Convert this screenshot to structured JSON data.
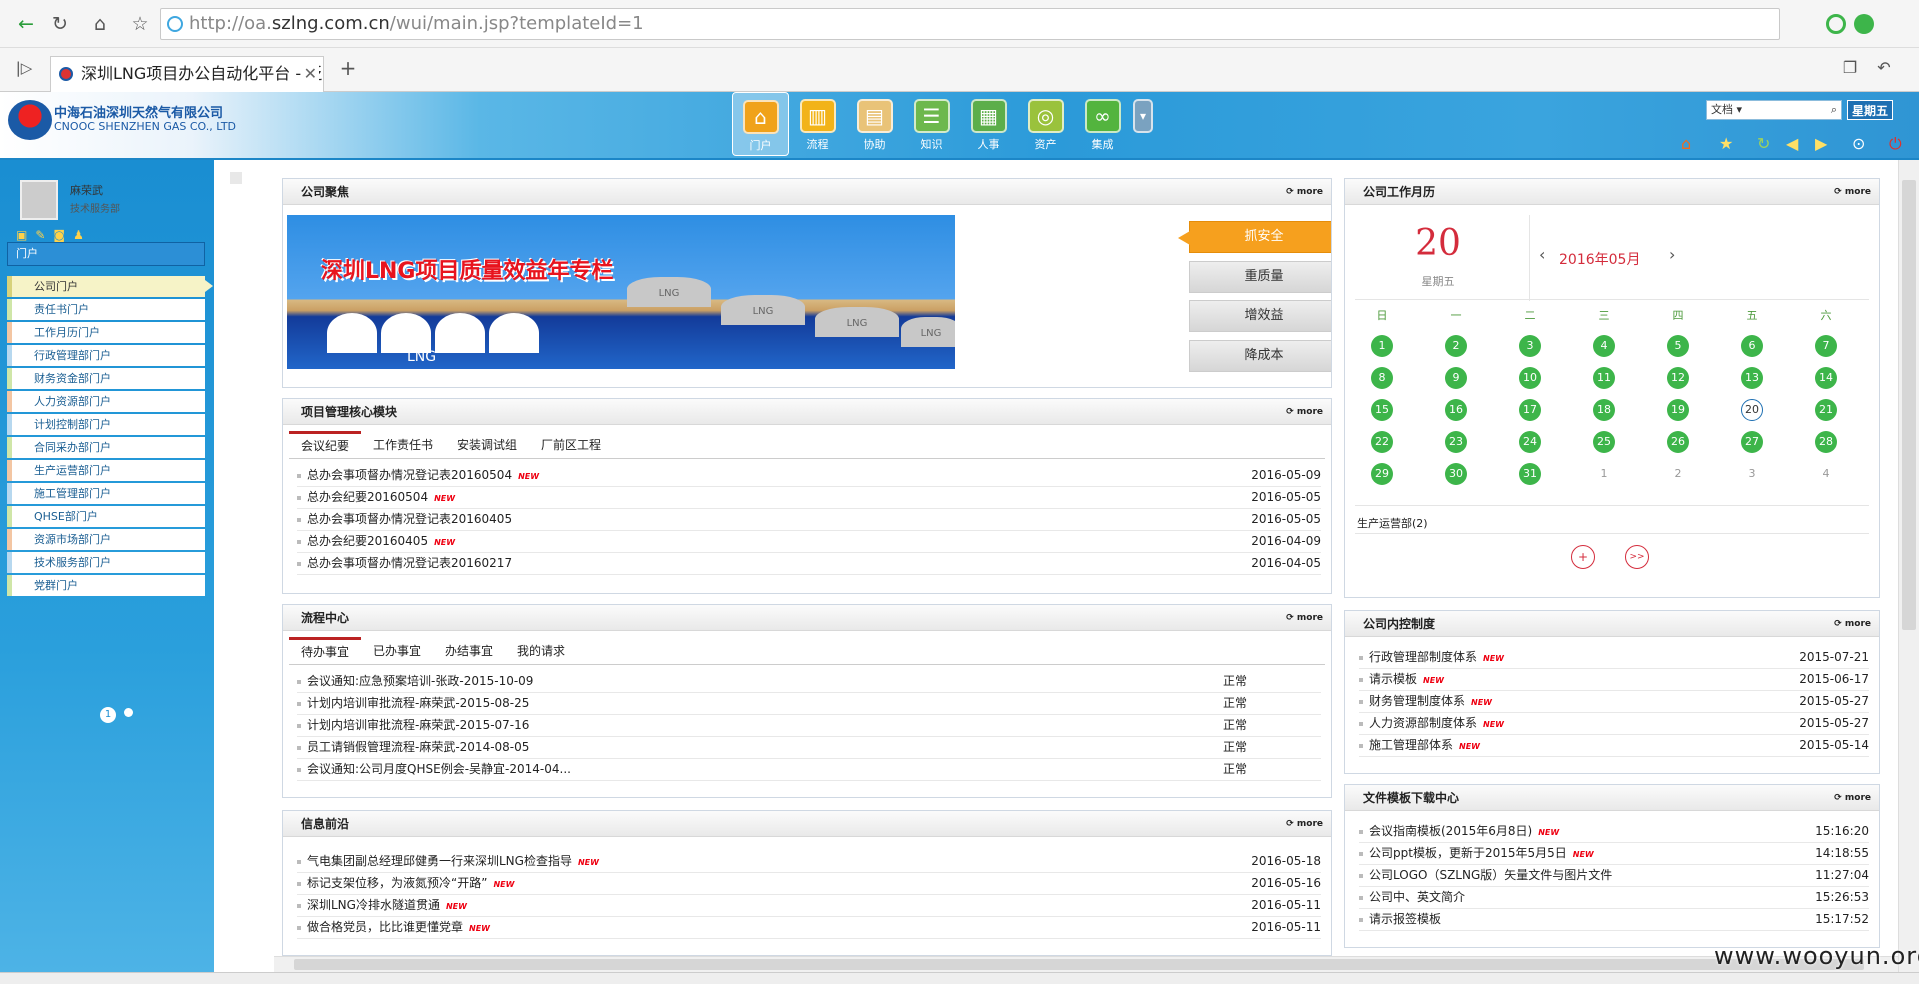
{
  "browser": {
    "url_prefix": "http://oa.",
    "url_host": "szlng.com.cn",
    "url_path": "/wui/main.jsp?templateId=1",
    "tab_title": "深圳LNG项目办公自动化平台 - 泛"
  },
  "header": {
    "company_cn": "中海石油深圳天然气有限公司",
    "company_en": "CNOOC SHENZHEN GAS CO., LTD",
    "modules": [
      "门户",
      "流程",
      "协助",
      "知识",
      "人事",
      "资产",
      "集成"
    ],
    "search_value": "文档",
    "weekday": "星期五"
  },
  "sidebar": {
    "user_name": "麻荣武",
    "user_dept": "技术服务部",
    "portal_select": "门户",
    "items": [
      "公司门户",
      "责任书门户",
      "工作月历门户",
      "行政管理部门户",
      "财务资金部门户",
      "人力资源部门户",
      "计划控制部门户",
      "合同采办部门户",
      "生产运营部门户",
      "施工管理部门户",
      "QHSE部门户",
      "资源市场部门户",
      "技术服务部门户",
      "党群门户"
    ],
    "page_num": "1"
  },
  "focus": {
    "title": "公司聚焦",
    "more": "more",
    "banner_title": "深圳LNG项目质量效益年专栏",
    "banner_lng": "LNG",
    "tank_label": "LNG",
    "buttons": [
      "抓安全",
      "重质量",
      "增效益",
      "降成本"
    ]
  },
  "core": {
    "title": "项目管理核心模块",
    "more": "more",
    "tabs": [
      "会议纪要",
      "工作责任书",
      "安装调试组",
      "厂前区工程"
    ],
    "rows": [
      {
        "text": "总办会事项督办情况登记表20160504",
        "date": "2016-05-09",
        "new": "NEW"
      },
      {
        "text": "总办会纪要20160504",
        "date": "2016-05-05",
        "new": "NEW"
      },
      {
        "text": "总办会事项督办情况登记表20160405",
        "date": "2016-05-05",
        "new": ""
      },
      {
        "text": "总办会纪要20160405",
        "date": "2016-04-09",
        "new": "NEW"
      },
      {
        "text": "总办会事项督办情况登记表20160217",
        "date": "2016-04-05",
        "new": ""
      }
    ]
  },
  "flow": {
    "title": "流程中心",
    "more": "more",
    "tabs": [
      "待办事宜",
      "已办事宜",
      "办结事宜",
      "我的请求"
    ],
    "rows": [
      {
        "text": "会议通知:应急预案培训-张政-2015-10-09",
        "status": "正常"
      },
      {
        "text": "计划内培训审批流程-麻荣武-2015-08-25",
        "status": "正常"
      },
      {
        "text": "计划内培训审批流程-麻荣武-2015-07-16",
        "status": "正常"
      },
      {
        "text": "员工请销假管理流程-麻荣武-2014-08-05",
        "status": "正常"
      },
      {
        "text": "会议通知:公司月度QHSE例会-吴静宜-2014-04...",
        "status": "正常"
      }
    ]
  },
  "news": {
    "title": "信息前沿",
    "more": "more",
    "rows": [
      {
        "text": "气电集团副总经理邱健勇一行来深圳LNG检查指导",
        "date": "2016-05-18",
        "new": "NEW"
      },
      {
        "text": "标记支架位移，为液氮预冷“开路”",
        "date": "2016-05-16",
        "new": "NEW"
      },
      {
        "text": "深圳LNG冷排水隧道贯通",
        "date": "2016-05-11",
        "new": "NEW"
      },
      {
        "text": "做合格党员，比比谁更懂党章",
        "date": "2016-05-11",
        "new": "NEW"
      }
    ]
  },
  "calendar": {
    "title": "公司工作月历",
    "more": "more",
    "day": "20",
    "weekday": "星期五",
    "month": "2016年05月",
    "prev": "‹",
    "next": "›",
    "weekdays": [
      "日",
      "一",
      "二",
      "三",
      "四",
      "五",
      "六"
    ],
    "days": [
      "1",
      "2",
      "3",
      "4",
      "5",
      "6",
      "7",
      "8",
      "9",
      "10",
      "11",
      "12",
      "13",
      "14",
      "15",
      "16",
      "17",
      "18",
      "19",
      "20",
      "21",
      "22",
      "23",
      "24",
      "25",
      "26",
      "27",
      "28",
      "29",
      "30",
      "31"
    ],
    "trailing": [
      "1",
      "2",
      "3",
      "4"
    ],
    "today": "20",
    "note": "生产运营部(2)",
    "add": "+",
    "forward": ">>"
  },
  "control": {
    "title": "公司内控制度",
    "more": "more",
    "rows": [
      {
        "text": "行政管理部制度体系",
        "date": "2015-07-21",
        "new": "NEW"
      },
      {
        "text": "请示模板",
        "date": "2015-06-17",
        "new": "NEW"
      },
      {
        "text": "财务管理制度体系",
        "date": "2015-05-27",
        "new": "NEW"
      },
      {
        "text": "人力资源部制度体系",
        "date": "2015-05-27",
        "new": "NEW"
      },
      {
        "text": "施工管理部体系",
        "date": "2015-05-14",
        "new": "NEW"
      }
    ]
  },
  "downloads": {
    "title": "文件模板下载中心",
    "more": "more",
    "rows": [
      {
        "text": "会议指南模板(2015年6月8日)",
        "date": "15:16:20",
        "new": "NEW"
      },
      {
        "text": "公司ppt模板，更新于2015年5月5日",
        "date": "14:18:55",
        "new": "NEW"
      },
      {
        "text": "公司LOGO（SZLNG版）矢量文件与图片文件",
        "date": "11:27:04",
        "new": ""
      },
      {
        "text": "公司中、英文简介",
        "date": "15:26:53",
        "new": ""
      },
      {
        "text": "请示报签模板",
        "date": "15:17:52",
        "new": ""
      }
    ]
  },
  "watermark": "www.wooyun.org",
  "colors": {
    "accent": "#1a8ed2",
    "calendar_green": "#3db54a",
    "red": "#d42c3c",
    "orange": "#f6a01e"
  }
}
